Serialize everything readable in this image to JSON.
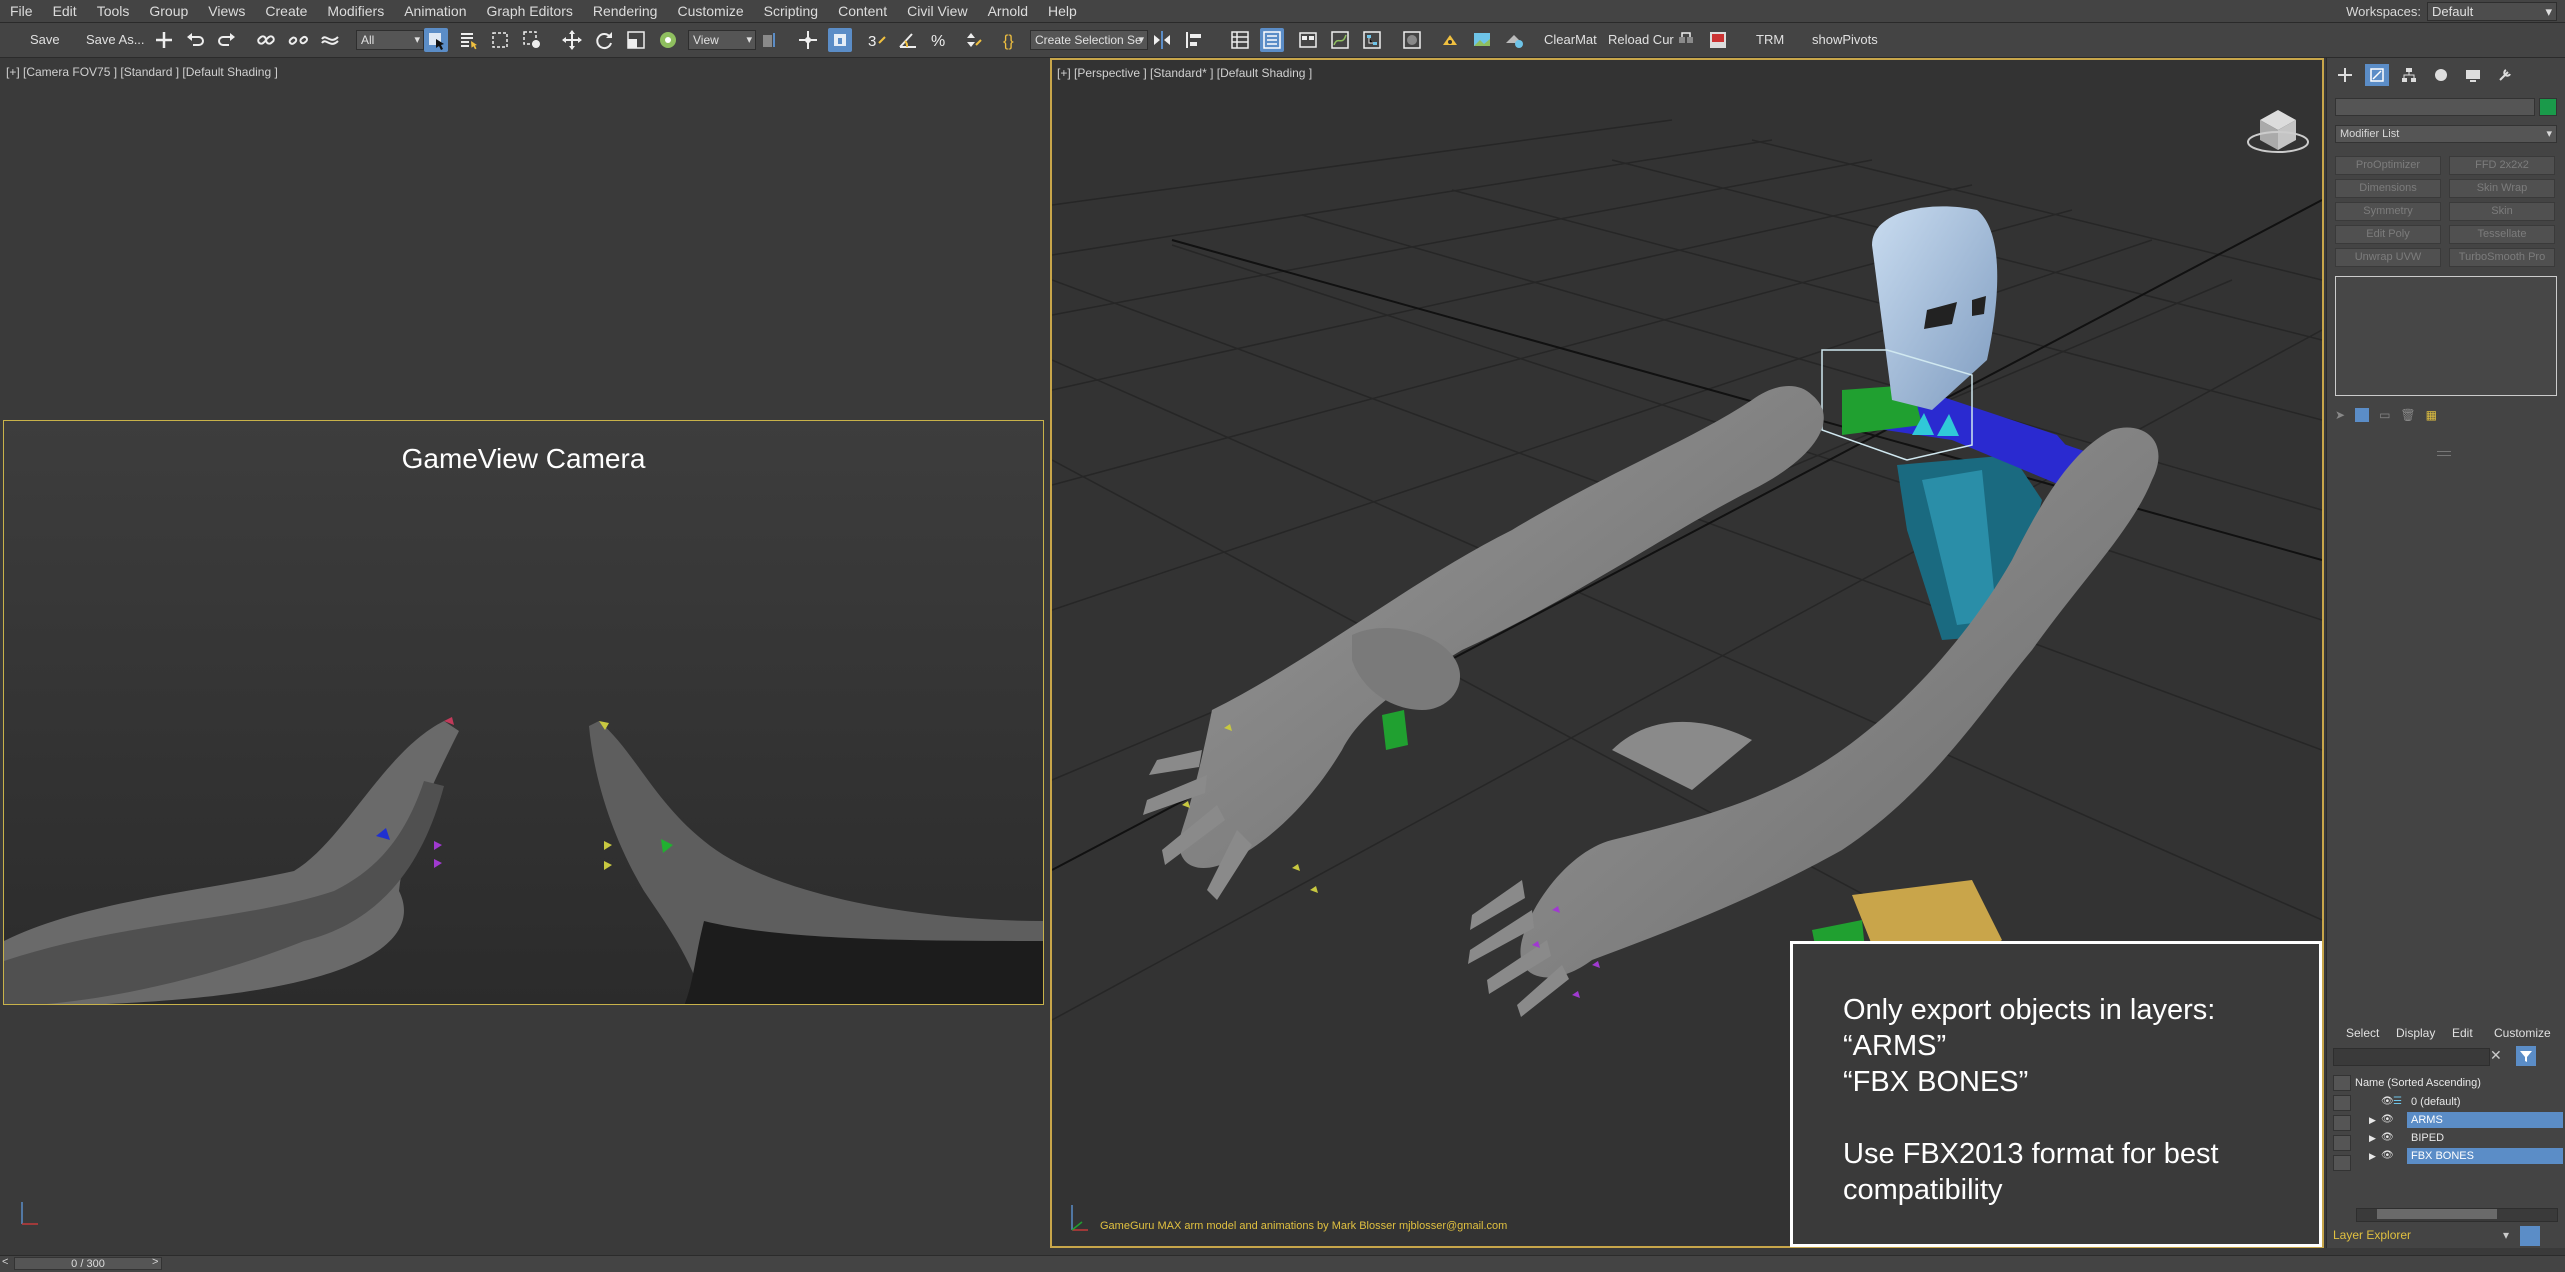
{
  "menubar": {
    "items": [
      "File",
      "Edit",
      "Tools",
      "Group",
      "Views",
      "Create",
      "Modifiers",
      "Animation",
      "Graph Editors",
      "Rendering",
      "Customize",
      "Scripting",
      "Content",
      "Civil View",
      "Arnold",
      "Help"
    ],
    "workspaces_label": "Workspaces:",
    "workspace_value": "Default"
  },
  "toolbar": {
    "save_label": "Save",
    "save_as_label": "Save As...",
    "filter_value": "All",
    "view_value": "View",
    "selection_set_value": "Create Selection Se",
    "clearmat_label": "ClearMat",
    "reloadcur_label": "Reload Cur",
    "trm_label": "TRM",
    "showpivots_label": "showPivots"
  },
  "left_viewport": {
    "label": "[+] [Camera FOV75 ] [Standard ] [Default Shading ]",
    "camera_title": "GameView Camera"
  },
  "right_viewport": {
    "label": "[+] [Perspective ] [Standard* ] [Default Shading ]",
    "credit": "GameGuru MAX arm model and animations by Mark Blosser mjblosser@gmail.com",
    "notice": {
      "line1": "Only export objects in layers:",
      "line2": "“ARMS”",
      "line3": "“FBX BONES”",
      "line4": "Use FBX2013 format for best",
      "line5": "compatibility"
    }
  },
  "command_panel": {
    "modifier_list_label": "Modifier List",
    "modifier_buttons": [
      "ProOptimizer",
      "FFD 2x2x2",
      "Dimensions",
      "Skin Wrap",
      "Symmetry",
      "Skin",
      "Edit Poly",
      "Tessellate",
      "Unwrap UVW",
      "TurboSmooth Pro"
    ],
    "name_color": "#1a9a4a"
  },
  "scene_explorer": {
    "menu": [
      "Select",
      "Display",
      "Edit",
      "Customize"
    ],
    "sort_header": "Name (Sorted Ascending)",
    "layers": [
      {
        "name": "0 (default)",
        "selected": false
      },
      {
        "name": "ARMS",
        "selected": true
      },
      {
        "name": "BIPED",
        "selected": false
      },
      {
        "name": "FBX BONES",
        "selected": true
      }
    ],
    "explorer_select_value": "Layer Explorer"
  },
  "status": {
    "time_slider": "0 / 300"
  },
  "colors": {
    "accent": "#5b8dc7",
    "viewport_border": "#c8a64a",
    "credit_text": "#e0c040"
  }
}
